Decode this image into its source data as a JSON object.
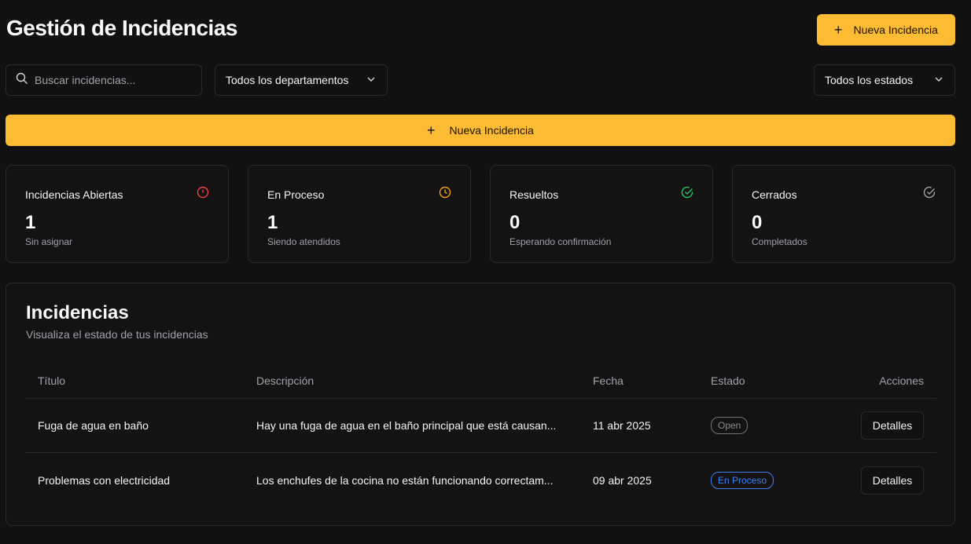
{
  "header": {
    "title": "Gestión de Incidencias",
    "new_button": "Nueva Incidencia"
  },
  "filters": {
    "search_placeholder": "Buscar incidencias...",
    "department_select": "Todos los departamentos",
    "state_select": "Todos los estados"
  },
  "wide_button": "Nueva Incidencia",
  "colors": {
    "accent": "#fbbb32",
    "open": "#ef4444",
    "in_progress": "#f59e0b",
    "resolved": "#22c55e",
    "closed": "#a1a1aa"
  },
  "stats": [
    {
      "title": "Incidencias Abiertas",
      "value": "1",
      "subtitle": "Sin asignar",
      "icon": "alert-circle-icon"
    },
    {
      "title": "En Proceso",
      "value": "1",
      "subtitle": "Siendo atendidos",
      "icon": "clock-icon"
    },
    {
      "title": "Resueltos",
      "value": "0",
      "subtitle": "Esperando confirmación",
      "icon": "check-circle-icon"
    },
    {
      "title": "Cerrados",
      "value": "0",
      "subtitle": "Completados",
      "icon": "check-circle-icon"
    }
  ],
  "incidents": {
    "title": "Incidencias",
    "subtitle": "Visualiza el estado de tus incidencias",
    "columns": [
      "Título",
      "Descripción",
      "Fecha",
      "Estado",
      "Acciones"
    ],
    "rows": [
      {
        "title": "Fuga de agua en baño",
        "description": "Hay una fuga de agua en el baño principal que está causan...",
        "date": "11 abr 2025",
        "status": "Open",
        "action": "Detalles"
      },
      {
        "title": "Problemas con electricidad",
        "description": "Los enchufes de la cocina no están funcionando correctam...",
        "date": "09 abr 2025",
        "status": "En Proceso",
        "action": "Detalles"
      }
    ]
  }
}
